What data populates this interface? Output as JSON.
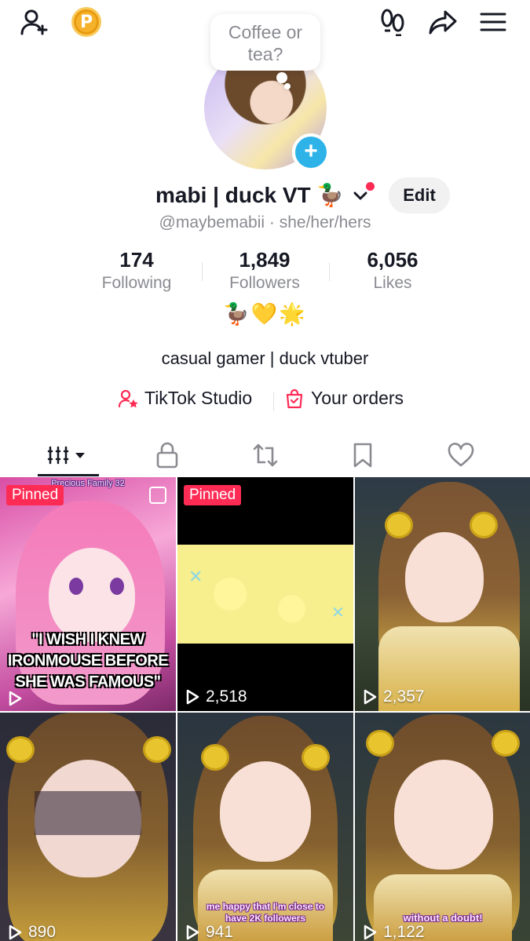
{
  "topbar": {
    "add_friend_icon": "person-plus-icon",
    "coin_label": "P",
    "footprints_icon": "footprints-icon",
    "share_icon": "share-arrow-icon",
    "menu_icon": "hamburger-menu-icon"
  },
  "profile": {
    "bubble_text_line1": "Coffee or",
    "bubble_text_line2": "tea?",
    "avatar_plus": "+",
    "display_name": "mabi | duck VT 🦆",
    "edit_label": "Edit",
    "handle": "@maybemabii · she/her/hers",
    "emojis": "🦆💛🌟",
    "bio": "casual gamer | duck vtuber"
  },
  "stats": [
    {
      "value": "174",
      "label": "Following"
    },
    {
      "value": "1,849",
      "label": "Followers"
    },
    {
      "value": "6,056",
      "label": "Likes"
    }
  ],
  "tools": {
    "studio_label": "TikTok Studio",
    "orders_label": "Your orders"
  },
  "tabs": [
    "videos-tab",
    "private-tab",
    "reposts-tab",
    "favorites-tab",
    "liked-tab"
  ],
  "videos": [
    {
      "pinned": "Pinned",
      "views": "",
      "caption": "\"I WISH I KNEW IRONMOUSE BEFORE SHE WAS FAMOUS\"",
      "header": "Precious Family 32"
    },
    {
      "pinned": "Pinned",
      "views": "2,518"
    },
    {
      "pinned": "",
      "views": "2,357"
    },
    {
      "pinned": "",
      "views": "890"
    },
    {
      "pinned": "",
      "views": "941",
      "caption": "me happy that I'm close to have 2K followers"
    },
    {
      "pinned": "",
      "views": "1,122",
      "caption": "without a doubt!"
    }
  ],
  "colors": {
    "accent": "#fe2c55",
    "text_primary": "#161823",
    "text_secondary": "#8a8b91",
    "avatar_plus": "#2db3e8",
    "coin": "#f6b12a"
  }
}
